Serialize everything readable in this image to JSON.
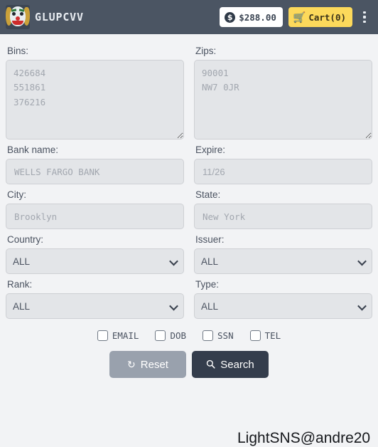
{
  "header": {
    "brand_name": "GLUPCVV",
    "logo_icon": "clown-avatar-icon",
    "balance": "$288.00",
    "balance_icon": "dollar-coin-icon",
    "coin_glyph": "$",
    "cart_label": "Cart(0)",
    "cart_icon": "shopping-cart-icon",
    "cart_glyph": "🛒",
    "menu_icon": "kebab-menu-icon",
    "bg_color": "#4b5563",
    "cart_color": "#fcd95b"
  },
  "form": {
    "bins": {
      "label": "Bins:",
      "value": "",
      "placeholder": "426684\n551861\n376216"
    },
    "zips": {
      "label": "Zips:",
      "value": "",
      "placeholder": "90001\nNW7 0JR"
    },
    "bank_name": {
      "label": "Bank name:",
      "value": "",
      "placeholder": "WELLS FARGO BANK"
    },
    "expire": {
      "label": "Expire:",
      "value": "",
      "placeholder": "11/26"
    },
    "city": {
      "label": "City:",
      "value": "",
      "placeholder": "Brooklyn"
    },
    "state": {
      "label": "State:",
      "value": "",
      "placeholder": "New York"
    },
    "country": {
      "label": "Country:",
      "selected": "ALL",
      "options": [
        "ALL"
      ]
    },
    "issuer": {
      "label": "Issuer:",
      "selected": "ALL",
      "options": [
        "ALL"
      ]
    },
    "rank": {
      "label": "Rank:",
      "selected": "ALL",
      "options": [
        "ALL"
      ]
    },
    "type": {
      "label": "Type:",
      "selected": "ALL",
      "options": [
        "ALL"
      ]
    },
    "checkboxes": [
      {
        "label": "EMAIL",
        "checked": false
      },
      {
        "label": "DOB",
        "checked": false
      },
      {
        "label": "SSN",
        "checked": false
      },
      {
        "label": "TEL",
        "checked": false
      }
    ],
    "reset_button": {
      "label": "Reset",
      "icon": "refresh-icon",
      "glyph": "↻",
      "color": "#99a1ad"
    },
    "search_button": {
      "label": "Search",
      "icon": "search-icon",
      "glyph": "⌕",
      "color": "#343d4c"
    }
  },
  "watermark": {
    "text": "LightSNS@andre20"
  }
}
